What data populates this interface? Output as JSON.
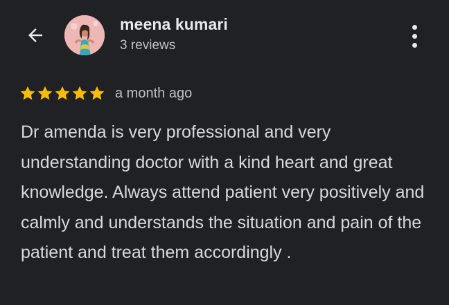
{
  "reviewer": {
    "name": "meena kumari",
    "review_count": "3 reviews",
    "avatar_icon": "profile-photo"
  },
  "navigation": {
    "back_icon": "arrow-back-icon",
    "more_icon": "more-vert-icon"
  },
  "review": {
    "rating": 5,
    "max_rating": 5,
    "time_ago": "a month ago",
    "text": "Dr amenda is very professional and very understanding doctor with a kind heart and great knowledge. Always attend patient very positively and calmly and understands the situation and pain of the patient and treat them accordingly ."
  },
  "colors": {
    "background": "#202124",
    "star": "#fbbc04",
    "primary_text": "#e8eaed",
    "secondary_text": "#bdc1c6"
  }
}
